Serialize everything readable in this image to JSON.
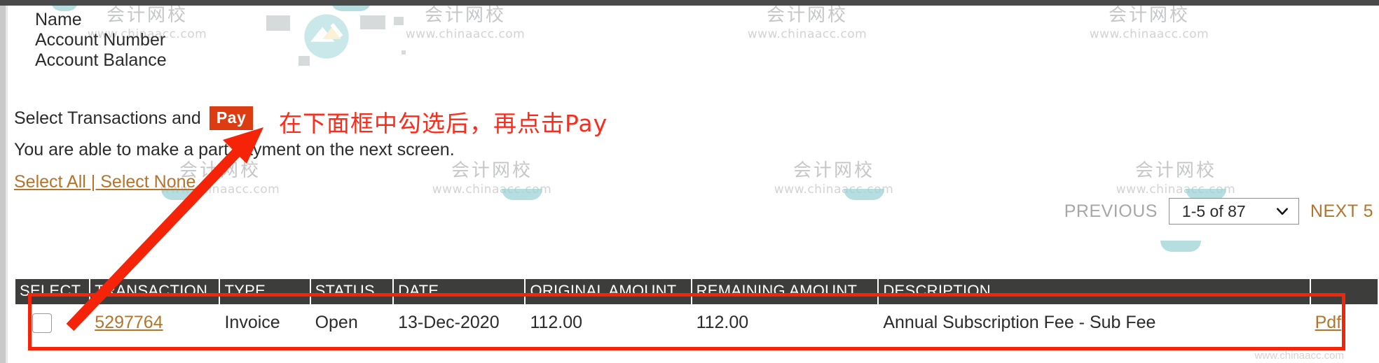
{
  "account": {
    "lines": [
      "Name",
      "Account Number",
      "Account Balance"
    ]
  },
  "actions": {
    "select_transactions_label": "Select Transactions and",
    "pay_button": "Pay",
    "part_payment_note": "You are able to make a part payment on the next screen.",
    "select_all": "Select All",
    "separator": " | ",
    "select_none": "Select None"
  },
  "annotation": {
    "text": "在下面框中勾选后，再点击Pay",
    "color": "#ff2a1a"
  },
  "pagination": {
    "previous": "PREVIOUS",
    "range": "1-5 of 87",
    "next": "NEXT 5"
  },
  "table": {
    "headers": {
      "select": "SELECT",
      "transaction": "TRANSACTION",
      "type": "TYPE",
      "status": "STATUS",
      "date": "DATE",
      "original_amount": "ORIGINAL AMOUNT",
      "remaining_amount": "REMAINING AMOUNT",
      "description": "DESCRIPTION",
      "pdf": ""
    },
    "rows": [
      {
        "transaction": "5297764",
        "type": "Invoice",
        "status": "Open",
        "date": "13-Dec-2020",
        "original_amount": "112.00",
        "remaining_amount": "112.00",
        "description": "Annual Subscription Fee - Sub Fee",
        "pdf": "Pdf"
      }
    ]
  },
  "watermark": {
    "cn": "会计网校",
    "url": "www.chinaacc.com"
  },
  "colors": {
    "pay_button_bg": "#dd3c13",
    "link": "#b5742a",
    "table_header_bg": "#3d3d3b",
    "annotation_red": "#f52307"
  }
}
